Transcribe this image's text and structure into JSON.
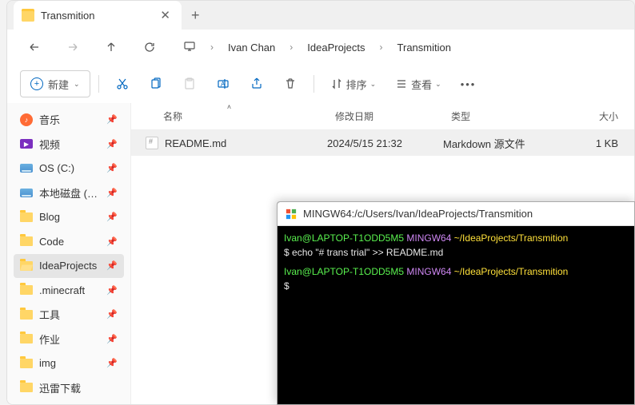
{
  "tab": {
    "title": "Transmition"
  },
  "breadcrumb": {
    "pc_icon": "monitor-icon",
    "parts": [
      "Ivan Chan",
      "IdeaProjects",
      "Transmition"
    ]
  },
  "toolbar": {
    "new": "新建",
    "sort": "排序",
    "view": "查看"
  },
  "sidebar": {
    "items": [
      {
        "label": "音乐",
        "type": "music"
      },
      {
        "label": "视频",
        "type": "video"
      },
      {
        "label": "OS (C:)",
        "type": "drive"
      },
      {
        "label": "本地磁盘 (D:)",
        "type": "drive"
      },
      {
        "label": "Blog",
        "type": "folder"
      },
      {
        "label": "Code",
        "type": "folder"
      },
      {
        "label": "IdeaProjects",
        "type": "folder-open",
        "active": true
      },
      {
        "label": ".minecraft",
        "type": "folder"
      },
      {
        "label": "工具",
        "type": "folder"
      },
      {
        "label": "作业",
        "type": "folder"
      },
      {
        "label": "img",
        "type": "folder"
      },
      {
        "label": "迅雷下载",
        "type": "folder"
      }
    ]
  },
  "columns": {
    "name": "名称",
    "date": "修改日期",
    "type": "类型",
    "size": "大小"
  },
  "files": [
    {
      "name": "README.md",
      "date": "2024/5/15 21:32",
      "type": "Markdown 源文件",
      "size": "1 KB"
    }
  ],
  "terminal": {
    "title": "MINGW64:/c/Users/Ivan/IdeaProjects/Transmition",
    "prompt_user": "Ivan@LAPTOP-T1ODD5M5",
    "prompt_sys": "MINGW64",
    "prompt_path": "~/IdeaProjects/Transmition",
    "cmd1": "echo \"# trans trial\" >> README.md"
  }
}
